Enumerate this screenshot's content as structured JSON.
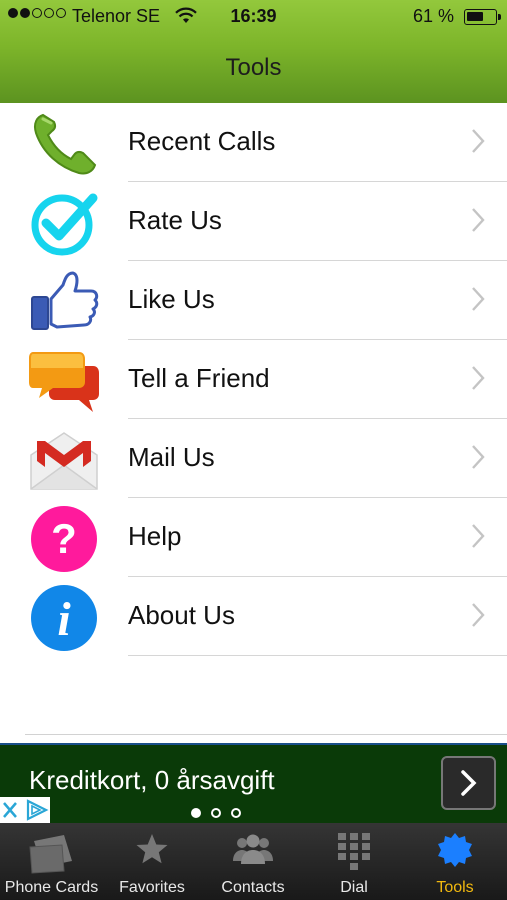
{
  "status_bar": {
    "carrier": "Telenor SE",
    "time": "16:39",
    "battery_percent": "61 %",
    "battery_level": 0.61,
    "signal_bars_filled": 2,
    "signal_bars_total": 5
  },
  "nav": {
    "title": "Tools"
  },
  "menu": {
    "items": [
      {
        "label": "Recent Calls",
        "icon": "phone-icon"
      },
      {
        "label": "Rate Us",
        "icon": "checkmark-icon"
      },
      {
        "label": "Like Us",
        "icon": "thumbs-up-icon"
      },
      {
        "label": "Tell a Friend",
        "icon": "speech-bubbles-icon"
      },
      {
        "label": "Mail Us",
        "icon": "gmail-envelope-icon"
      },
      {
        "label": "Help",
        "icon": "question-mark-icon"
      },
      {
        "label": "About Us",
        "icon": "info-icon"
      }
    ]
  },
  "ad": {
    "text": "Kreditkort, 0 årsavgift",
    "page_count": 3,
    "current_page": 1
  },
  "tabbar": {
    "tabs": [
      {
        "label": "Phone Cards",
        "icon": "phone-cards-icon",
        "active": false
      },
      {
        "label": "Favorites",
        "icon": "star-icon",
        "active": false
      },
      {
        "label": "Contacts",
        "icon": "contacts-group-icon",
        "active": false
      },
      {
        "label": "Dial",
        "icon": "keypad-icon",
        "active": false
      },
      {
        "label": "Tools",
        "icon": "gear-badge-icon",
        "active": true
      }
    ]
  },
  "colors": {
    "header_green": "#7db52a",
    "active_tab": "#f2b90f",
    "ad_background": "#0a3a08",
    "help_pink": "#ff1a9c",
    "info_blue": "#1187e8",
    "rate_cyan": "#16d4ee"
  }
}
